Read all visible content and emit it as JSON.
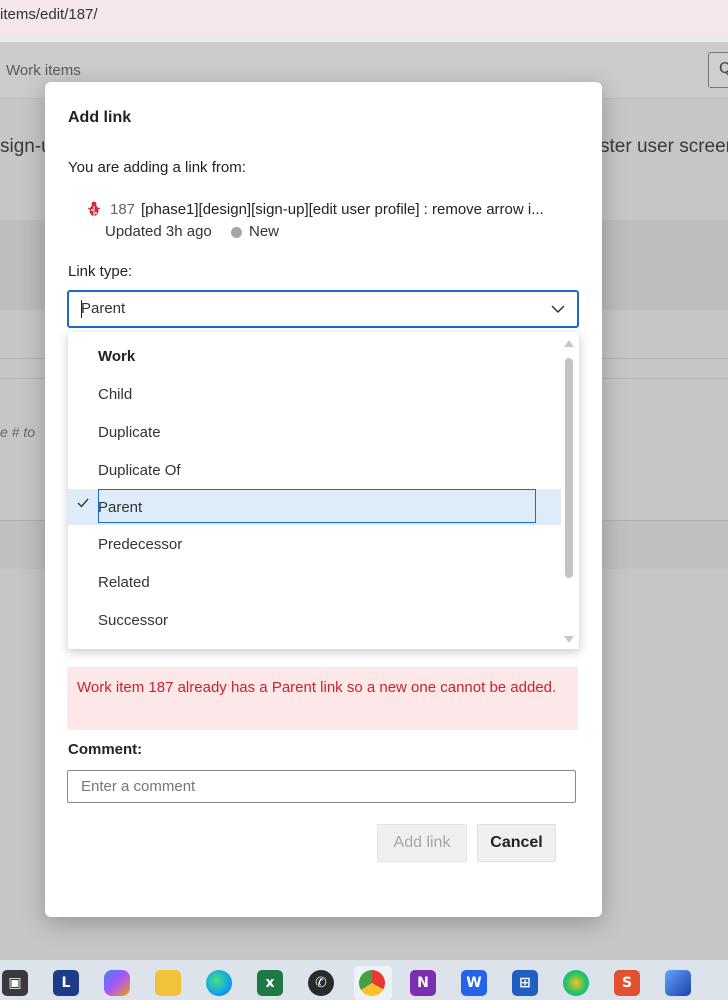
{
  "browser": {
    "url": "items/edit/187/"
  },
  "background": {
    "breadcrumb": "Work items",
    "title_left": "sign-u",
    "title_right": "ster user screen",
    "hint": "e # to"
  },
  "dialog": {
    "title": "Add link",
    "subtitle": "You are adding a link from:",
    "work_item": {
      "id": "187",
      "title": "[phase1][design][sign-up][edit user profile] : remove arrow i...",
      "updated": "Updated 3h ago",
      "state": "New"
    },
    "link_type_label": "Link type:",
    "link_type_value": "Parent",
    "dropdown": {
      "group_header": "Work",
      "options": [
        "Child",
        "Duplicate",
        "Duplicate Of",
        "Parent",
        "Predecessor",
        "Related",
        "Successor"
      ],
      "selected": "Parent"
    },
    "error": "Work item 187 already has a Parent link so a new one cannot be added.",
    "comment_label": "Comment:",
    "comment_placeholder": "Enter a comment",
    "add_button": "Add link",
    "cancel_button": "Cancel"
  },
  "colors": {
    "accent": "#1a6cc6",
    "error_text": "#c4262e",
    "error_bg": "#fde7e9",
    "bug_icon": "#cc293d"
  },
  "taskbar": {
    "icons": [
      "task-view-icon",
      "l-app-icon",
      "copilot-icon",
      "file-explorer-icon",
      "edge-icon",
      "excel-icon",
      "whatsapp-icon",
      "chrome-icon",
      "onenote-icon",
      "word-icon",
      "microsoft-store-icon",
      "edge-dev-icon",
      "s-app-icon",
      "photos-icon"
    ]
  }
}
